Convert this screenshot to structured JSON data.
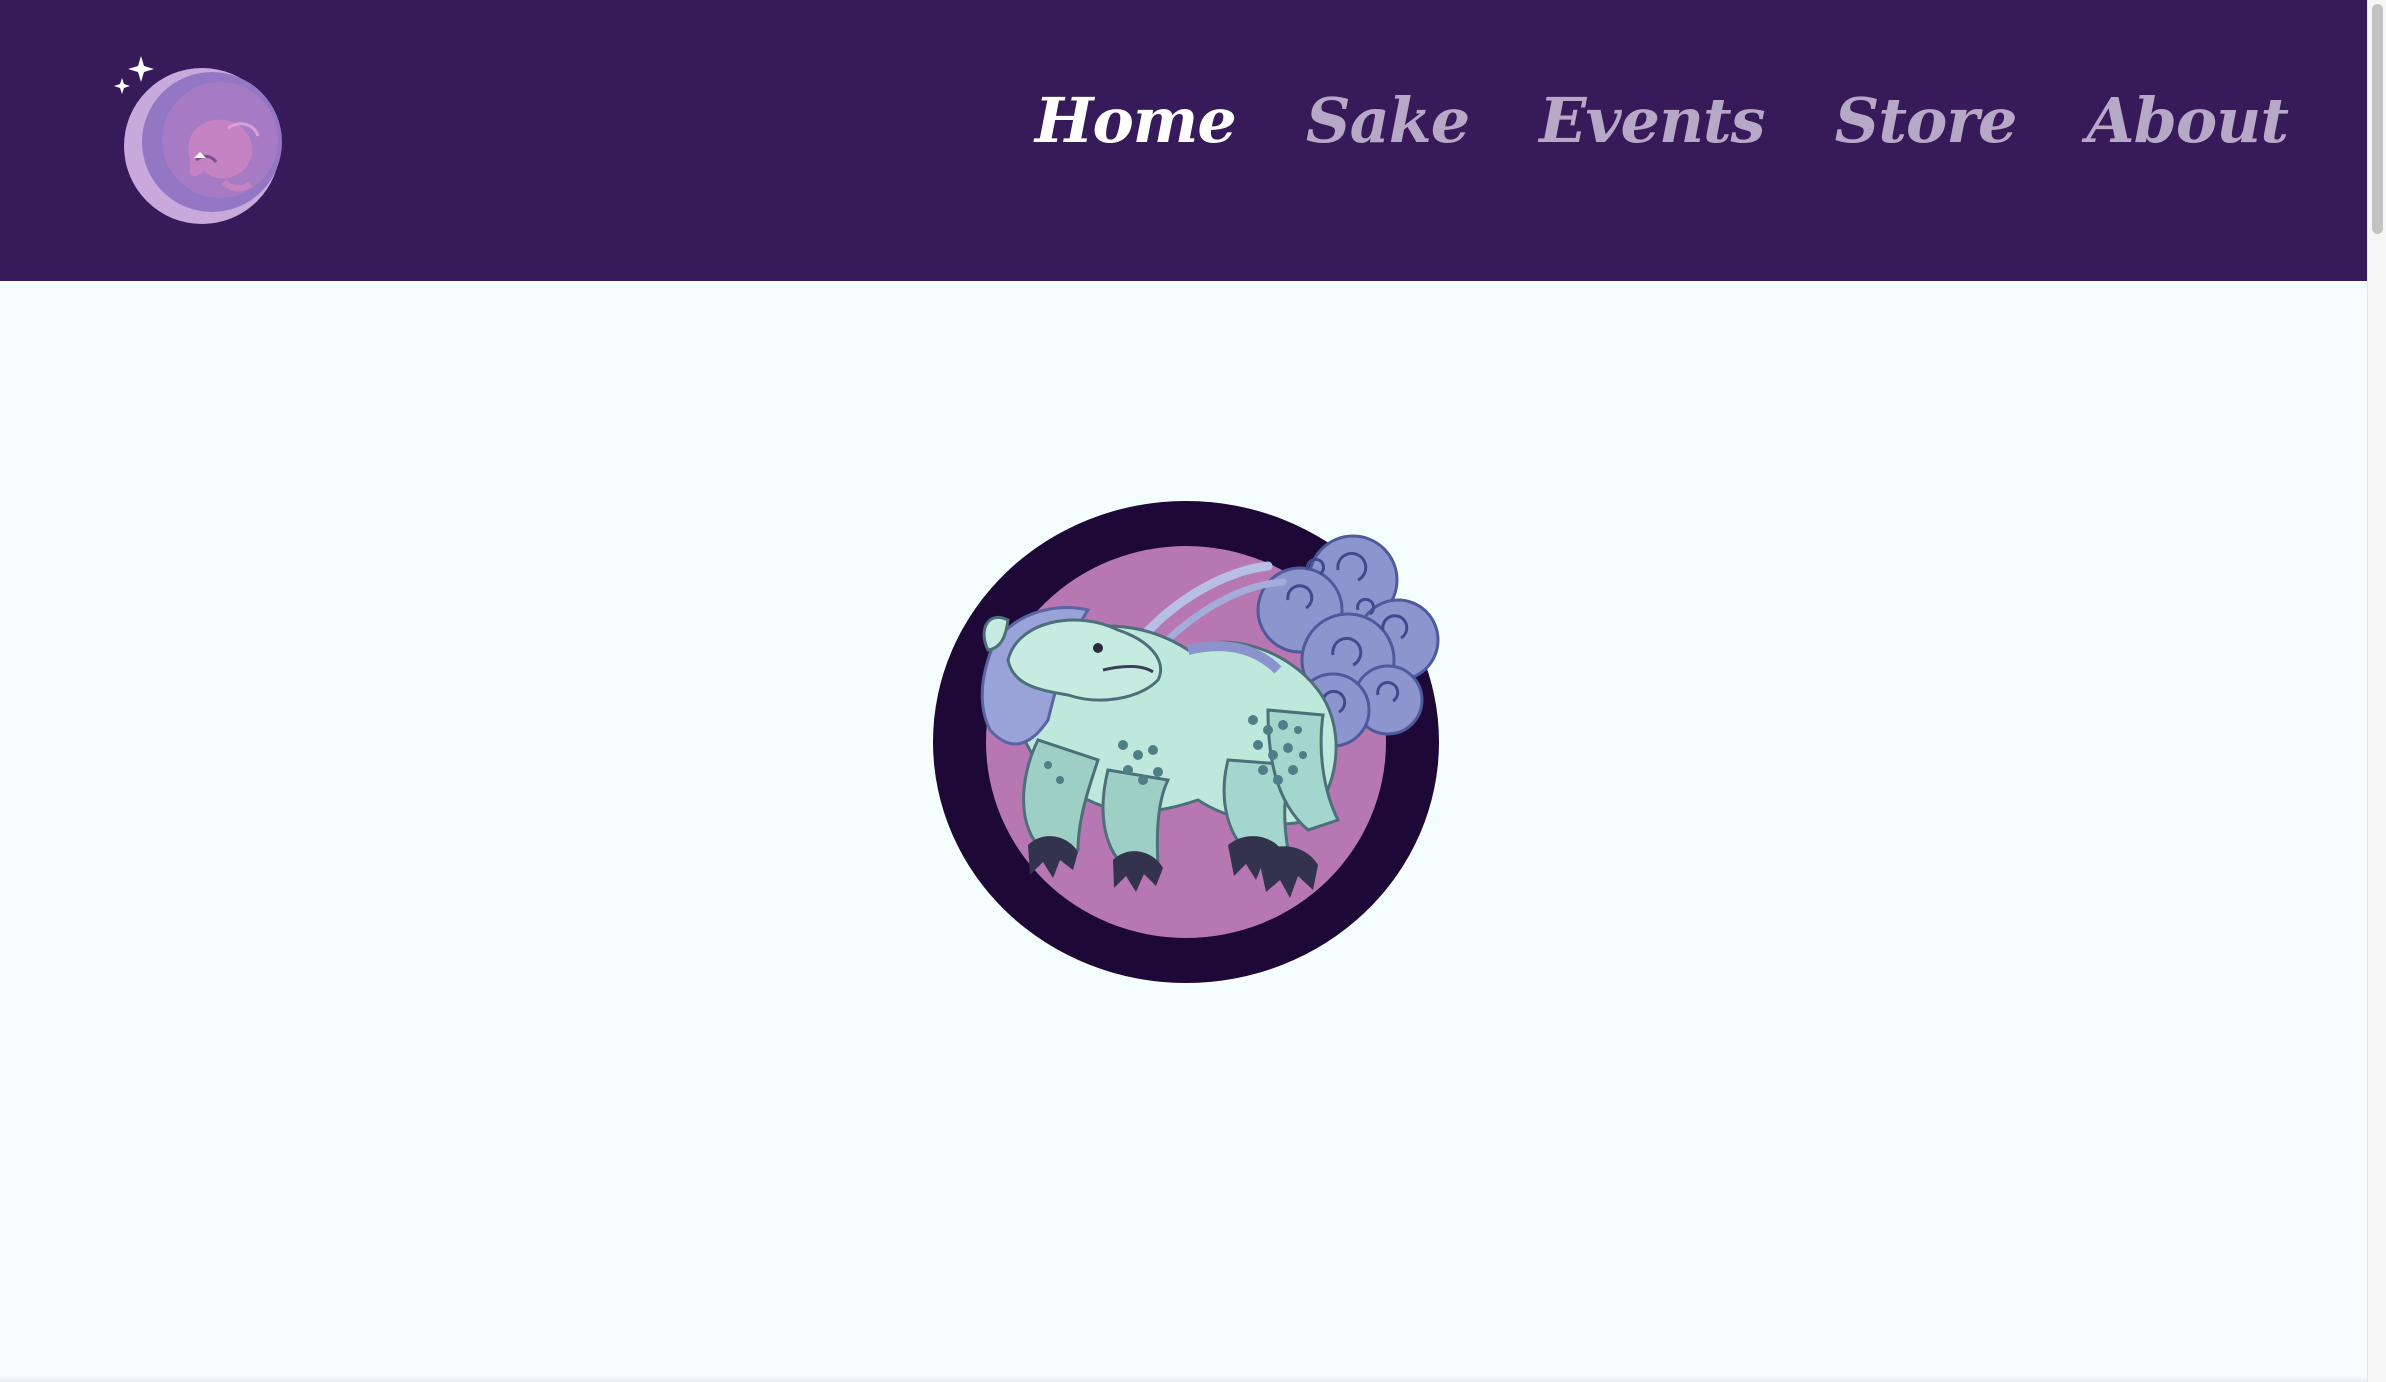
{
  "header": {
    "background": "#371a59",
    "logo_icon": "moon-creature-logo-icon"
  },
  "nav": {
    "items": [
      {
        "label": "Home",
        "active": true
      },
      {
        "label": "Sake",
        "active": false
      },
      {
        "label": "Events",
        "active": false
      },
      {
        "label": "Store",
        "active": false
      },
      {
        "label": "About",
        "active": false
      }
    ],
    "active_color": "#ffffff",
    "inactive_color": "#b8a8c8"
  },
  "main": {
    "background": "#f4fefe",
    "hero_icon": "kirin-emblem-icon",
    "emblem_ring_color": "#1e0838",
    "emblem_fill_color": "#b677b3"
  }
}
